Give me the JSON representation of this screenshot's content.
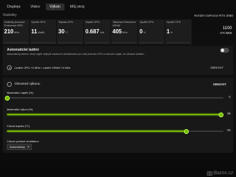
{
  "tabs": [
    {
      "label": "Displeje",
      "active": false
    },
    {
      "label": "Video",
      "active": false
    },
    {
      "label": "Výkon",
      "active": true
    },
    {
      "label": "Můj stroj",
      "active": false
    }
  ],
  "section_title": "Statistiky",
  "gpu_name": "NVIDIA GeForce RTX 3060",
  "stats": [
    {
      "label": "Grafický procesor Frekvence GPU",
      "value": "210",
      "unit": "MHz"
    },
    {
      "label": "Využití GPU",
      "value": "11",
      "unit": "Wattů"
    },
    {
      "label": "Teplota GPU",
      "value": "30",
      "unit": "°C"
    },
    {
      "label": "Napětí GPU",
      "value": "0.687",
      "unit": "Volt"
    },
    {
      "label": "Taktovací frekvence VRAM",
      "value": "405",
      "unit": "MHz"
    },
    {
      "label": "Využití GPU",
      "value": "0",
      "unit": "%"
    },
    {
      "label": "Využití CPU",
      "value": "1",
      "unit": "%"
    }
  ],
  "extra_stat": {
    "value": "1100",
    "unit": "OT./MIN"
  },
  "auto_tuning": {
    "title": "Automatické ladění",
    "description": "Automatický skener, který najde nejlepší nastavení přetaktování pro vaši jednotku GPU a zároveň zajistí, že zůstane stabilní...",
    "chips": "Ladění GPU +0 MHz  •  Ladění VRAM +0 MHz",
    "reset_label": "OBNOVIT",
    "enabled": false
  },
  "manual_tuning": {
    "title": "Ohromné výkonu",
    "reset_label": "OBNOVIT",
    "sliders": [
      {
        "label": "Maximální napětí (%)",
        "value": 0,
        "max": 100,
        "display": "0"
      },
      {
        "label": "Maximální výkon (%)",
        "value": 99,
        "max": 100,
        "display": "99"
      },
      {
        "label": "Cílová teplota (°C)",
        "value": 83,
        "max": 100,
        "display": "83"
      }
    ],
    "fan_label": "Cílová rychlost ventilátoru",
    "fan_value": "Automaticky"
  },
  "watermark": "Bazos.cz",
  "colors": {
    "accent": "#76b900",
    "background": "#0c0c0c",
    "panel": "#181818"
  }
}
